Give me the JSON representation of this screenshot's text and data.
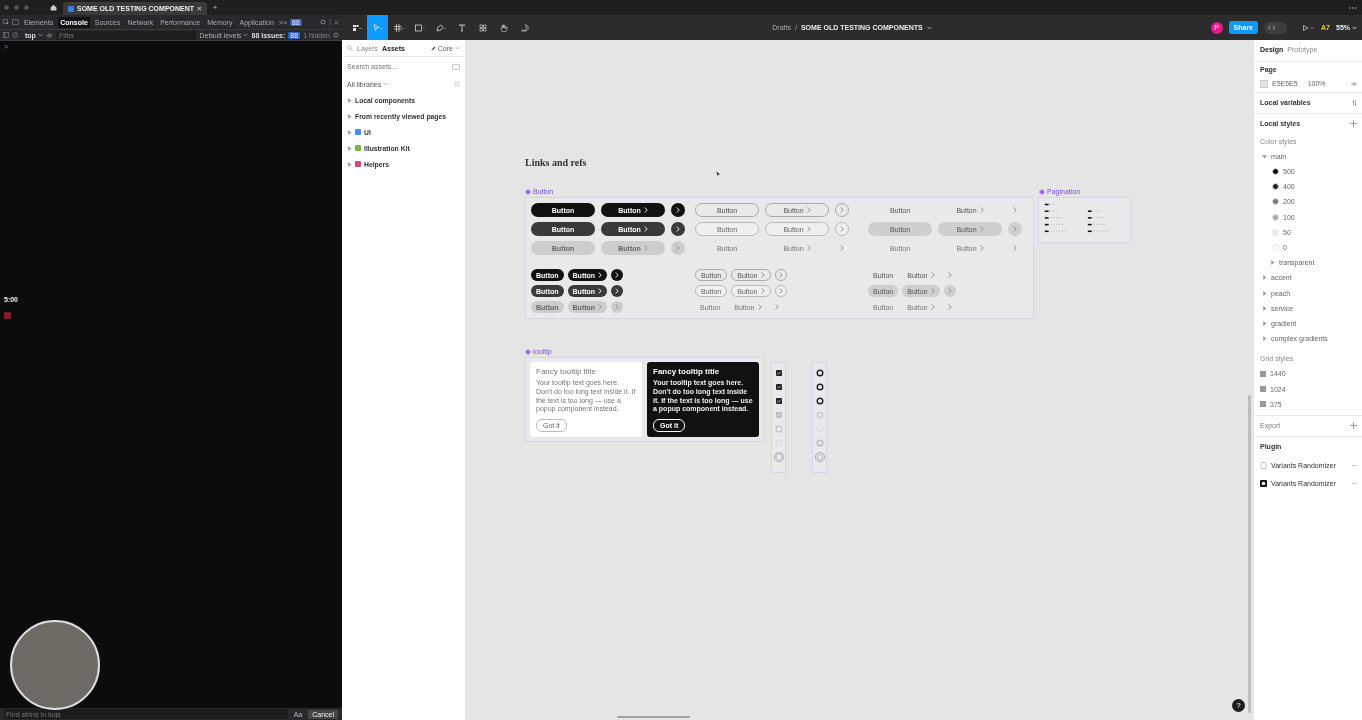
{
  "browser_tab": {
    "title": "SOME OLD TESTING COMPONENT",
    "close": "×",
    "new_tab": "+"
  },
  "devtools": {
    "tabs": [
      {
        "label": "Elements",
        "selected": false
      },
      {
        "label": "Console",
        "selected": true
      },
      {
        "label": "Sources",
        "selected": false
      },
      {
        "label": "Network",
        "selected": false
      },
      {
        "label": "Performance",
        "selected": false
      },
      {
        "label": "Memory",
        "selected": false
      },
      {
        "label": "Application",
        "selected": false
      }
    ],
    "more": ">>",
    "issues_badge": "88",
    "context": "top",
    "filter_placeholder": "Filter",
    "levels": "Default levels",
    "issues_label": "88 Issues:",
    "issues_count": "88",
    "hidden": "1 hidden",
    "prompt": ">",
    "console_line": "5:00",
    "find_placeholder": "Find string in logs",
    "match_case": "Aa",
    "cancel": "Cancel"
  },
  "toolbar": {
    "tools": [
      {
        "kind": "main-menu",
        "selected": false
      },
      {
        "kind": "move",
        "selected": true
      },
      {
        "kind": "frame",
        "selected": false
      },
      {
        "kind": "shape",
        "selected": false
      },
      {
        "kind": "pen",
        "selected": false
      },
      {
        "kind": "text",
        "selected": false
      },
      {
        "kind": "components",
        "selected": false
      },
      {
        "kind": "hand",
        "selected": false
      },
      {
        "kind": "comment",
        "selected": false
      }
    ],
    "folder": "Drafts",
    "separator": "/",
    "file": "SOME OLD TESTING COMPONENTS",
    "avatar": "P",
    "share": "Share",
    "dev_mode_on": false,
    "ai": "A7",
    "zoom": "55%"
  },
  "assets_panel": {
    "tabs": [
      {
        "label": "Layers",
        "selected": false
      },
      {
        "label": "Assets",
        "selected": true
      }
    ],
    "library": "Core",
    "search_placeholder": "Search assets...",
    "filter": "All libraries",
    "sections": [
      {
        "label": "Local components",
        "kind": "plain"
      },
      {
        "label": "From recently viewed pages",
        "kind": "plain"
      },
      {
        "label": "UI",
        "kind": "library",
        "color": "#3d8bfd"
      },
      {
        "label": "Illustration Kit",
        "kind": "library",
        "color": "#7cb342"
      },
      {
        "label": "Helpers",
        "kind": "library",
        "color": "#d9467a"
      }
    ]
  },
  "canvas": {
    "title": "Links and refs",
    "button_frame": {
      "label": "Button",
      "large_groups": [
        {
          "kind": "filled",
          "rows": [
            {
              "hovered": false,
              "disabled": false,
              "labels": [
                "Button",
                "Button"
              ]
            },
            {
              "hovered": true,
              "disabled": false,
              "labels": [
                "Button",
                "Button"
              ]
            },
            {
              "hovered": false,
              "disabled": true,
              "labels": [
                "Button",
                "Button"
              ]
            }
          ]
        },
        {
          "kind": "outline",
          "rows": [
            {
              "hovered": false,
              "disabled": false,
              "labels": [
                "Button",
                "Button"
              ]
            },
            {
              "hovered": true,
              "disabled": false,
              "labels": [
                "Button",
                "Button"
              ]
            },
            {
              "hovered": false,
              "disabled": true,
              "labels": [
                "Button",
                "Button"
              ]
            }
          ]
        },
        {
          "kind": "ghost",
          "rows": [
            {
              "hovered": false,
              "disabled": false,
              "labels": [
                "Button",
                "Button"
              ]
            },
            {
              "hovered": true,
              "disabled": false,
              "labels": [
                "Button",
                "Button"
              ]
            },
            {
              "hovered": false,
              "disabled": true,
              "labels": [
                "Button",
                "Button"
              ]
            }
          ]
        }
      ],
      "small_groups": [
        {
          "kind": "filled",
          "rows": [
            {
              "hovered": false,
              "disabled": false,
              "labels": [
                "Button",
                "Button"
              ]
            },
            {
              "hovered": true,
              "disabled": false,
              "labels": [
                "Button",
                "Button"
              ]
            },
            {
              "hovered": false,
              "disabled": true,
              "labels": [
                "Button",
                "Button"
              ]
            }
          ]
        },
        {
          "kind": "outline",
          "rows": [
            {
              "hovered": false,
              "disabled": false,
              "labels": [
                "Button",
                "Button"
              ]
            },
            {
              "hovered": true,
              "disabled": false,
              "labels": [
                "Button",
                "Button"
              ]
            },
            {
              "hovered": false,
              "disabled": true,
              "labels": [
                "Button",
                "Button"
              ]
            }
          ]
        },
        {
          "kind": "ghost",
          "rows": [
            {
              "hovered": false,
              "disabled": false,
              "labels": [
                "Button",
                "Button"
              ]
            },
            {
              "hovered": true,
              "disabled": false,
              "labels": [
                "Button",
                "Button"
              ]
            },
            {
              "hovered": false,
              "disabled": true,
              "labels": [
                "Button",
                "Button"
              ]
            }
          ]
        }
      ]
    },
    "pagination_frame": {
      "label": "Pagination"
    },
    "tooltip_frame": {
      "label": "tooltip",
      "tooltips": [
        {
          "kind": "light",
          "title": "Fancy tooltip title",
          "body": "Your tooltip text goes here. Don't do too long text inside it. If the text is too long — use a popup component instead.",
          "action": "Got it"
        },
        {
          "kind": "dark",
          "title": "Fancy tooltip title",
          "body": "Your tooltip text goes here. Don't do too long text inside it. If the text is too long — use a popup component instead.",
          "action": "Got it"
        }
      ]
    },
    "checkboxes": [
      {
        "checked": true,
        "disabled": false,
        "focused": false
      },
      {
        "checked": true,
        "disabled": false,
        "focused": false
      },
      {
        "checked": true,
        "disabled": false,
        "focused": false
      },
      {
        "checked": true,
        "disabled": true,
        "focused": false
      },
      {
        "checked": false,
        "disabled": false,
        "focused": false
      },
      {
        "checked": false,
        "disabled": true,
        "focused": false
      },
      {
        "checked": false,
        "disabled": false,
        "focused": true
      }
    ],
    "radios": [
      {
        "checked": true,
        "disabled": false,
        "focused": false
      },
      {
        "checked": true,
        "disabled": false,
        "focused": false
      },
      {
        "checked": true,
        "disabled": false,
        "focused": false
      },
      {
        "checked": false,
        "disabled": false,
        "focused": false
      },
      {
        "checked": false,
        "disabled": true,
        "focused": false
      },
      {
        "checked": true,
        "disabled": true,
        "focused": false
      },
      {
        "checked": false,
        "disabled": false,
        "focused": true
      }
    ],
    "help": "?"
  },
  "design_panel": {
    "tabs": [
      {
        "label": "Design",
        "selected": true
      },
      {
        "label": "Prototype",
        "selected": false
      }
    ],
    "page_heading": "Page",
    "page_color": "E5E5E5",
    "page_opacity": "100%",
    "local_variables": "Local variables",
    "local_styles": "Local styles",
    "color_styles_heading": "Color styles",
    "color_styles": [
      {
        "kind": "group",
        "label": "main",
        "expanded": true,
        "children": [
          {
            "kind": "swatch",
            "label": "500",
            "color": "#0a0a0a"
          },
          {
            "kind": "swatch",
            "label": "400",
            "color": "#1e1e1e"
          },
          {
            "kind": "swatch",
            "label": "200",
            "color": "#777777"
          },
          {
            "kind": "swatch",
            "label": "100",
            "color": "#a9a9a9"
          },
          {
            "kind": "swatch",
            "label": "50",
            "color": "#eeeeee"
          },
          {
            "kind": "swatch",
            "label": "0",
            "color": "#ffffff"
          },
          {
            "kind": "group",
            "label": "transparent",
            "expanded": false
          }
        ]
      },
      {
        "kind": "group",
        "label": "accent",
        "expanded": false
      },
      {
        "kind": "group",
        "label": "peach",
        "expanded": false
      },
      {
        "kind": "group",
        "label": "service",
        "expanded": false
      },
      {
        "kind": "group",
        "label": "gradient",
        "expanded": false
      },
      {
        "kind": "group",
        "label": "complex gradients",
        "expanded": false
      }
    ],
    "grid_styles_heading": "Grid styles",
    "grid_styles": [
      "1440",
      "1024",
      "375"
    ],
    "export": "Export",
    "plugin_heading": "Plugin",
    "plugins": [
      {
        "name": "Variants Randomizer",
        "kind": "outline"
      },
      {
        "name": "Variants Randomizer",
        "kind": "filled"
      }
    ]
  }
}
